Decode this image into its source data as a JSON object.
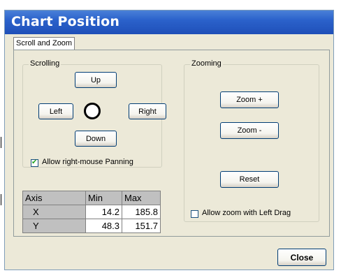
{
  "window": {
    "title": "Chart Position"
  },
  "tabs": [
    {
      "label": "Scroll and Zoom"
    }
  ],
  "scrolling": {
    "label": "Scrolling",
    "up_label": "Up",
    "down_label": "Down",
    "left_label": "Left",
    "right_label": "Right",
    "panning_checked": true,
    "panning_label": "Allow right-mouse Panning"
  },
  "axis_table": {
    "headers": [
      "Axis",
      "Min",
      "Max"
    ],
    "rows": [
      {
        "axis": "X",
        "min": "14.2",
        "max": "185.8"
      },
      {
        "axis": "Y",
        "min": "48.3",
        "max": "151.7"
      }
    ]
  },
  "zooming": {
    "label": "Zooming",
    "zoom_in_label": "Zoom +",
    "zoom_out_label": "Zoom -",
    "reset_label": "Reset",
    "left_drag_checked": false,
    "left_drag_label": "Allow zoom with Left Drag"
  },
  "footer": {
    "close_label": "Close"
  },
  "colors": {
    "title_bar": "#2b62cb",
    "title_text": "#ffffff",
    "dialog_bg": "#ece9d8",
    "checkmark": "#21a121"
  }
}
